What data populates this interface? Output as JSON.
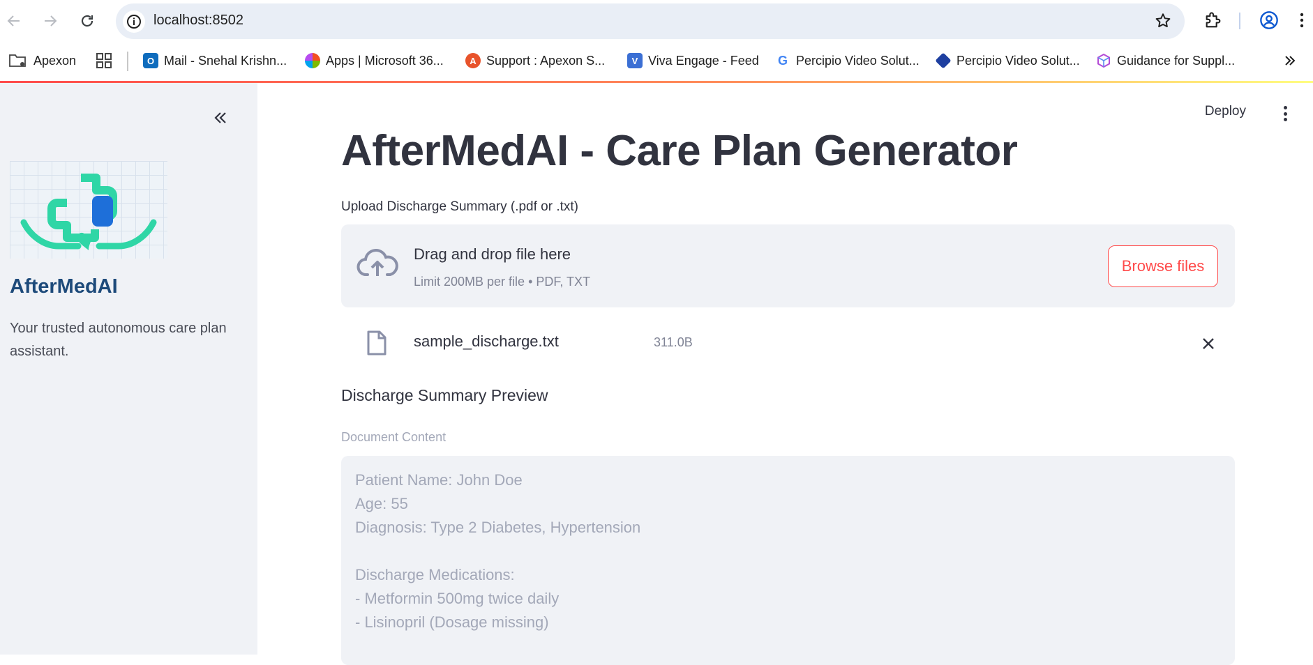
{
  "browser": {
    "url": "localhost:8502",
    "bookmarks": [
      {
        "label": "Apexon",
        "icon": "folder-gear-icon"
      },
      {
        "label": "Mail - Snehal Krishn...",
        "icon": "outlook-icon",
        "color": "#0f6cbd"
      },
      {
        "label": "Apps | Microsoft 36...",
        "icon": "microsoft365-icon"
      },
      {
        "label": "Support : Apexon S...",
        "icon": "apexon-support-icon",
        "color": "#e8532b"
      },
      {
        "label": "Viva Engage - Feed",
        "icon": "viva-engage-icon",
        "color": "#3b6fd4"
      },
      {
        "label": "Percipio Video Solut...",
        "icon": "google-icon"
      },
      {
        "label": "Percipio Video Solut...",
        "icon": "percipio-icon",
        "color": "#1e3fa0"
      },
      {
        "label": "Guidance for Suppl...",
        "icon": "cube-icon",
        "color": "#b44bd6"
      }
    ]
  },
  "sidebar": {
    "title": "AfterMedAI",
    "tagline": "Your trusted autonomous care plan assistant."
  },
  "header": {
    "deploy_label": "Deploy"
  },
  "main": {
    "title": "AfterMedAI - Care Plan Generator",
    "upload": {
      "label": "Upload Discharge Summary (.pdf or .txt)",
      "drop_title": "Drag and drop file here",
      "drop_subtitle": "Limit 200MB per file • PDF, TXT",
      "browse_label": "Browse files"
    },
    "file": {
      "name": "sample_discharge.txt",
      "size": "311.0B"
    },
    "preview": {
      "heading": "Discharge Summary Preview",
      "content_label": "Document Content",
      "content": "Patient Name: John Doe\nAge: 55\nDiagnosis: Type 2 Diabetes, Hypertension\n\nDischarge Medications:\n- Metformin 500mg twice daily\n- Lisinopril (Dosage missing)"
    }
  },
  "colors": {
    "accent": "#ff4b4b",
    "sidebar_bg": "#f0f2f6",
    "brand_blue": "#1d4a7a",
    "logo_teal": "#2fd6a6",
    "logo_blue": "#1e6fd9"
  }
}
